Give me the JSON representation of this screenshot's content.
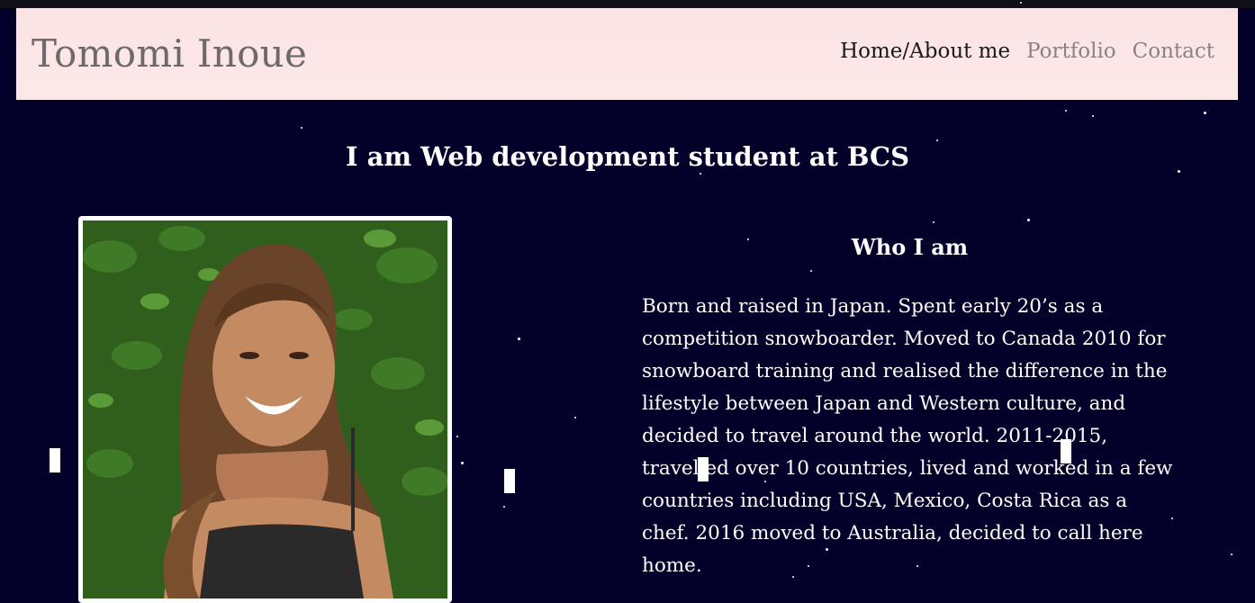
{
  "header": {
    "brand": "Tomomi Inoue",
    "nav": [
      {
        "label": "Home/About me",
        "active": true
      },
      {
        "label": "Portfolio",
        "active": false
      },
      {
        "label": "Contact",
        "active": false
      }
    ]
  },
  "hero": {
    "tagline": "I am Web development student at BCS"
  },
  "about": {
    "title": "Who I am",
    "bio": "Born and raised in Japan. Spent early 20’s as a competition snowboarder. Moved to Canada 2010 for snowboard training and realised the difference in the lifestyle between Japan and Western culture, and decided to travel around the world. 2011-2015, travelled over 10 countries, lived and worked in a few countries including USA, Mexico, Costa Rica as a chef. 2016 moved to Australia, decided to call here home."
  },
  "colors": {
    "background": "#03002a",
    "header_bg": "#fbe3e4",
    "brand_text": "#6e6a6c",
    "nav_active": "#1a1a1a",
    "nav_inactive": "#8a8384",
    "text": "#ffffff"
  }
}
